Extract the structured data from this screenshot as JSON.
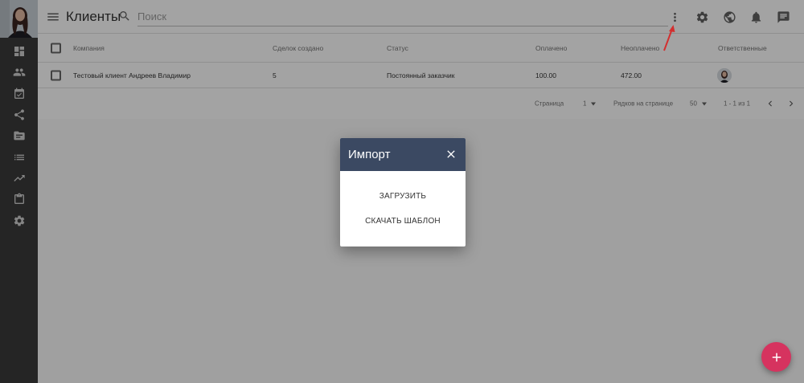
{
  "header": {
    "title": "Клиенты",
    "search_placeholder": "Поиск"
  },
  "table": {
    "columns": [
      "Компания",
      "Сделок создано",
      "Статус",
      "Оплачено",
      "Неоплачено",
      "Ответственные"
    ],
    "rows": [
      {
        "company": "Тестовый клиент Андреев Владимир",
        "deals": "5",
        "status": "Постоянный заказчик",
        "paid": "100.00",
        "unpaid": "472.00"
      }
    ]
  },
  "pagination": {
    "page_label": "Страница",
    "page_value": "1",
    "rows_label": "Рядков на странице",
    "rows_value": "50",
    "range": "1 - 1 из 1"
  },
  "dialog": {
    "title": "Импорт",
    "upload_label": "ЗАГРУЗИТЬ",
    "template_label": "СКАЧАТЬ ШАБЛОН"
  },
  "colors": {
    "sidebar": "#3a3a3a",
    "dialog_header": "#3b4962",
    "fab": "#d6335f",
    "annotation_arrow": "#d32f2f"
  },
  "icons": {
    "sidebar": [
      "dashboard-icon",
      "people-icon",
      "task-icon",
      "share-icon",
      "folder-icon",
      "list-icon",
      "trending-icon",
      "clipboard-icon",
      "settings-icon"
    ],
    "topbar": [
      "more-vert-icon",
      "gear-icon",
      "globe-icon",
      "bell-icon",
      "chat-icon"
    ]
  }
}
